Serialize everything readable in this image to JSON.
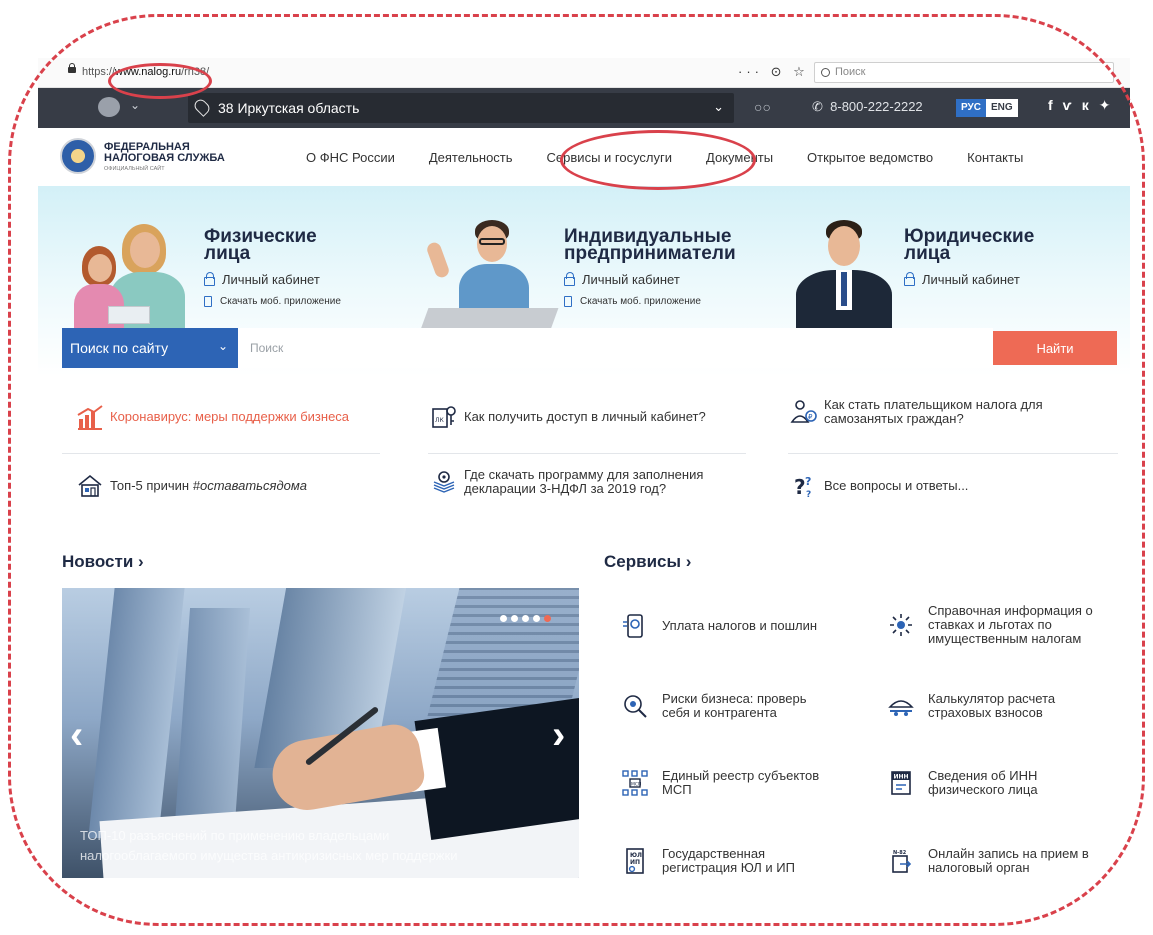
{
  "browser": {
    "url_prefix": "https://",
    "url_domain": "www.nalog.ru",
    "url_path": "/rn38/",
    "actions": "··· ⊙ ☆",
    "search_placeholder": "Поиск"
  },
  "topbar": {
    "region": "38 Иркутская область",
    "phone": "8-800-222-2222",
    "lang_ru": "РУС",
    "lang_en": "ENG",
    "social_fb": "f",
    "social_vk": "vk",
    "social_tw": "tw"
  },
  "header": {
    "logo_line1": "ФЕДЕРАЛЬНАЯ",
    "logo_line2": "НАЛОГОВАЯ СЛУЖБА",
    "logo_sub": "ОФИЦИАЛЬНЫЙ САЙТ",
    "nav": [
      "О ФНС России",
      "Деятельность",
      "Сервисы и госуслуги",
      "Документы",
      "Открытое ведомство",
      "Контакты"
    ]
  },
  "hero": {
    "individuals": {
      "title1": "Физические",
      "title2": "лица",
      "cabinet": "Личный кабинет",
      "app": "Скачать моб. приложение"
    },
    "entrepreneurs": {
      "title1": "Индивидуальные",
      "title2": "предприниматели",
      "cabinet": "Личный кабинет",
      "app": "Скачать моб. приложение"
    },
    "legal": {
      "title1": "Юридические",
      "title2": "лица",
      "cabinet": "Личный кабинет"
    }
  },
  "search": {
    "scope": "Поиск по сайту",
    "placeholder": "Поиск",
    "button": "Найти"
  },
  "quicklinks": {
    "covid": "Коронавирус: меры поддержки бизнеса",
    "cabinet_access": "Как получить доступ в личный кабинет?",
    "selfemployed1": "Как стать плательщиком налога для",
    "selfemployed2": "самозанятых граждан?",
    "top5_prefix": "Топ-5 причин ",
    "top5_tag": "#оставатьсядома",
    "ndfl1": "Где скачать программу для заполнения",
    "ndfl2": "декларации 3-НДФЛ за 2019 год?",
    "faq": "Все вопросы и ответы..."
  },
  "news": {
    "title": "Новости ›",
    "caption1": "ТОП-10 разъяснений по применению владельцами",
    "caption2": "налогооблагаемого имущества антикризисных мер поддержки"
  },
  "services": {
    "title": "Сервисы ›",
    "pay": "Уплата налогов и пошлин",
    "rates1": "Справочная информация о",
    "rates2": "ставках и льготах по",
    "rates3": "имущественным налогам",
    "risk1": "Риски бизнеса: проверь",
    "risk2": "себя и контрагента",
    "calc1": "Калькулятор расчета",
    "calc2": "страховых взносов",
    "msp1": "Единый реестр субъектов",
    "msp2": "МСП",
    "inn1": "Сведения об ИНН",
    "inn2": "физического лица",
    "reg1": "Государственная",
    "reg2": "регистрация ЮЛ и ИП",
    "appoint1": "Онлайн запись на прием в",
    "appoint2": "налоговый орган"
  },
  "colors": {
    "accent_blue": "#2d64b5",
    "accent_red": "#ee6a55",
    "dark_strip": "#373c46",
    "annotation": "#d9414b"
  }
}
